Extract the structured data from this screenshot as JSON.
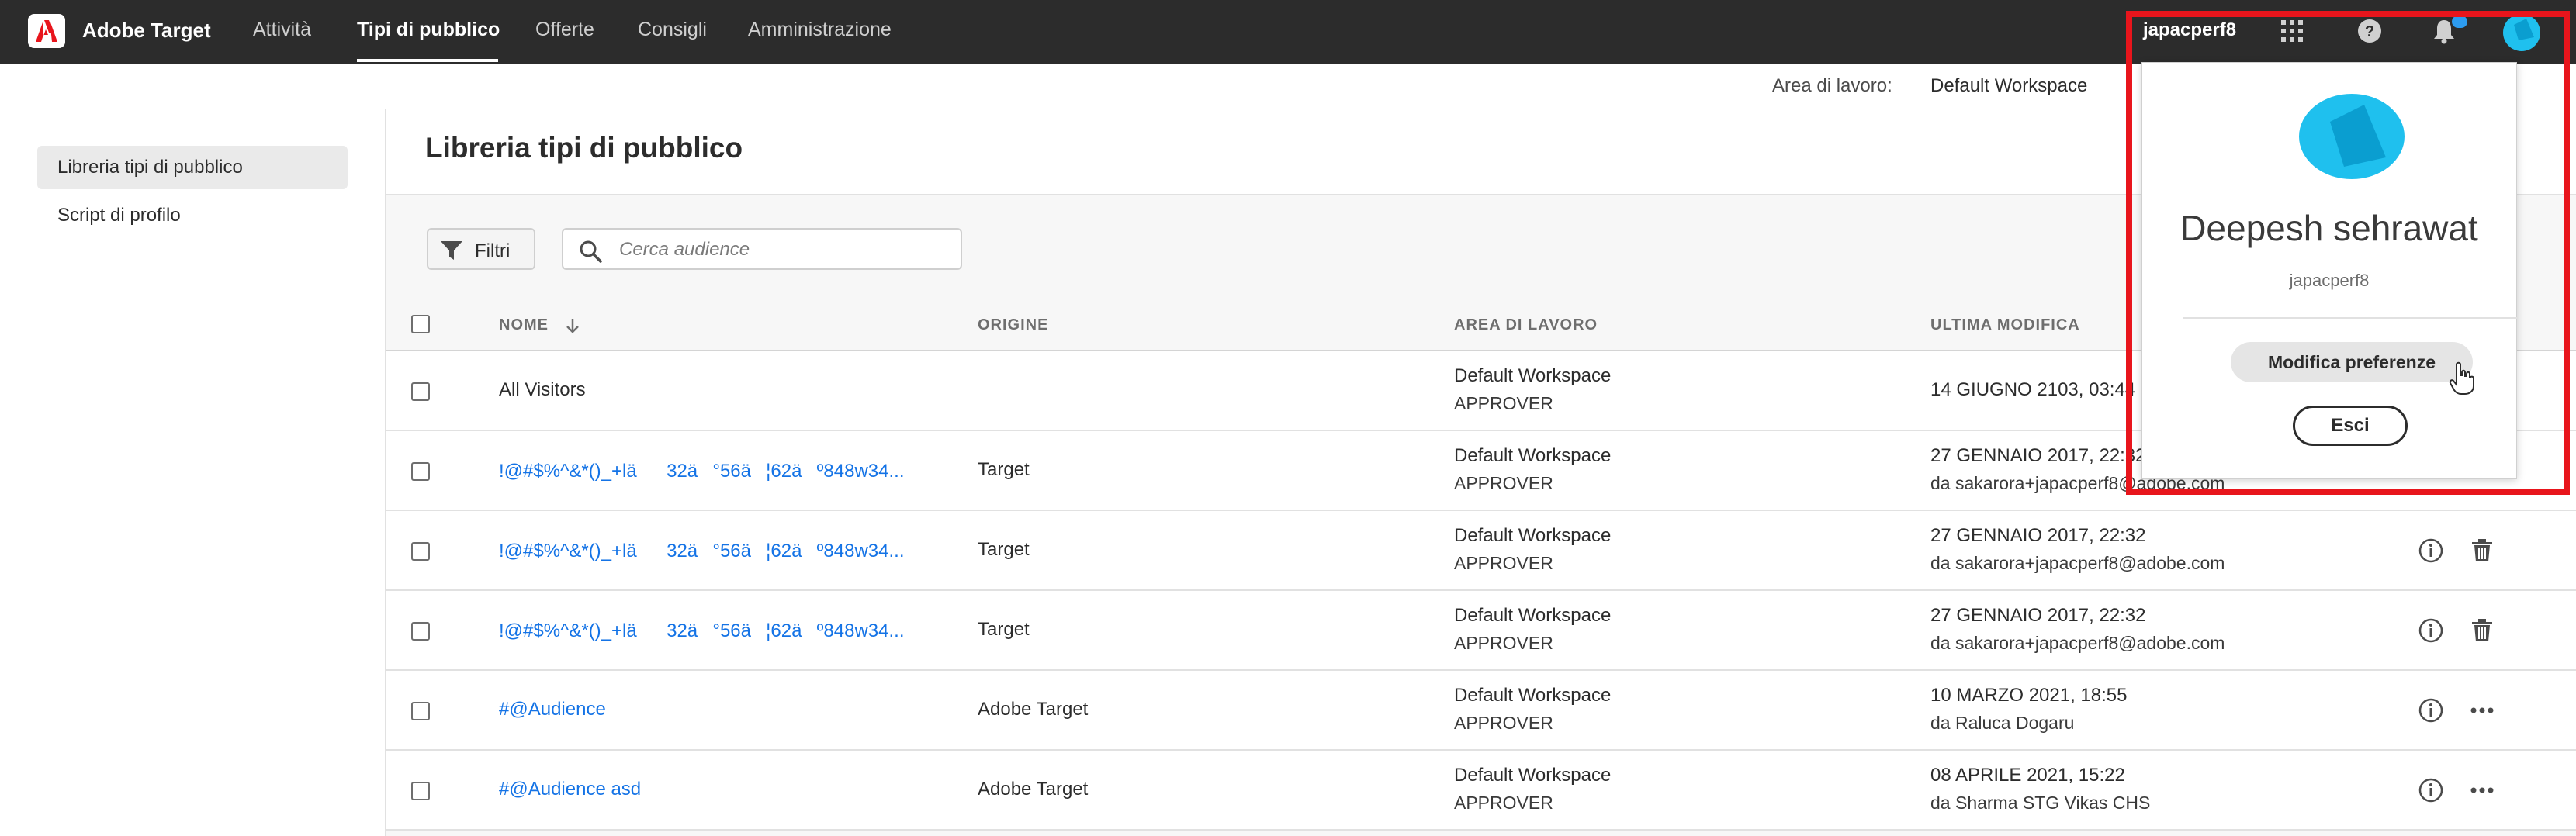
{
  "app": {
    "name": "Adobe Target"
  },
  "nav": {
    "items": [
      {
        "label": "Attività",
        "active": false
      },
      {
        "label": "Tipi di pubblico",
        "active": true
      },
      {
        "label": "Offerte",
        "active": false
      },
      {
        "label": "Consigli",
        "active": false
      },
      {
        "label": "Amministrazione",
        "active": false
      }
    ]
  },
  "header": {
    "user_id": "japacperf8",
    "icons": [
      "apps-grid-icon",
      "help-icon",
      "notification-bell-icon",
      "user-avatar"
    ]
  },
  "workspace": {
    "label": "Area di lavoro:",
    "value": "Default Workspace"
  },
  "sidebar": {
    "items": [
      {
        "label": "Libreria tipi di pubblico",
        "selected": true
      },
      {
        "label": "Script di profilo",
        "selected": false
      }
    ]
  },
  "main": {
    "title": "Libreria tipi di pubblico",
    "filter_label": "Filtri",
    "search_placeholder": "Cerca audience"
  },
  "table": {
    "columns": {
      "name": "NOME",
      "origin": "ORIGINE",
      "workspace": "AREA DI LAVORO",
      "modified": "ULTIMA MODIFICA"
    },
    "sort": {
      "column": "name",
      "direction": "descending"
    },
    "rows": [
      {
        "name": "All Visitors",
        "origin": "",
        "workspace": "Default Workspace",
        "role": "APPROVER",
        "modified": "14 GIUGNO 2103, 03:44",
        "by": ""
      },
      {
        "name": "!@#$%^&*()_+lä32ä°56ä¦62äº848w34...",
        "origin": "Target",
        "workspace": "Default Workspace",
        "role": "APPROVER",
        "modified": "27 GENNAIO 2017, 22:32",
        "by": "da sakarora+japacperf8@adobe.com"
      },
      {
        "name": "!@#$%^&*()_+lä32ä°56ä¦62äº848w34...",
        "origin": "Target",
        "workspace": "Default Workspace",
        "role": "APPROVER",
        "modified": "27 GENNAIO 2017, 22:32",
        "by": "da sakarora+japacperf8@adobe.com"
      },
      {
        "name": "!@#$%^&*()_+lä32ä°56ä¦62äº848w34...",
        "origin": "Target",
        "workspace": "Default Workspace",
        "role": "APPROVER",
        "modified": "27 GENNAIO 2017, 22:32",
        "by": "da sakarora+japacperf8@adobe.com"
      },
      {
        "name": "#@Audience",
        "origin": "Adobe Target",
        "workspace": "Default Workspace",
        "role": "APPROVER",
        "modified": "10 MARZO 2021, 18:55",
        "by": "da Raluca Dogaru"
      },
      {
        "name": "#@Audience asd",
        "origin": "Adobe Target",
        "workspace": "Default Workspace",
        "role": "APPROVER",
        "modified": "08 APRILE 2021, 15:22",
        "by": "da Sharma STG Vikas CHS"
      }
    ]
  },
  "profile_menu": {
    "full_name": "Deepesh sehrawat",
    "username": "japacperf8",
    "preferences_label": "Modifica preferenze",
    "logout_label": "Esci"
  },
  "colors": {
    "topbar": "#2c2c2c",
    "link": "#1473e6",
    "avatar": "#1fc0ee",
    "highlight": "#e8151c",
    "notification_dot": "#2d9cf0"
  }
}
